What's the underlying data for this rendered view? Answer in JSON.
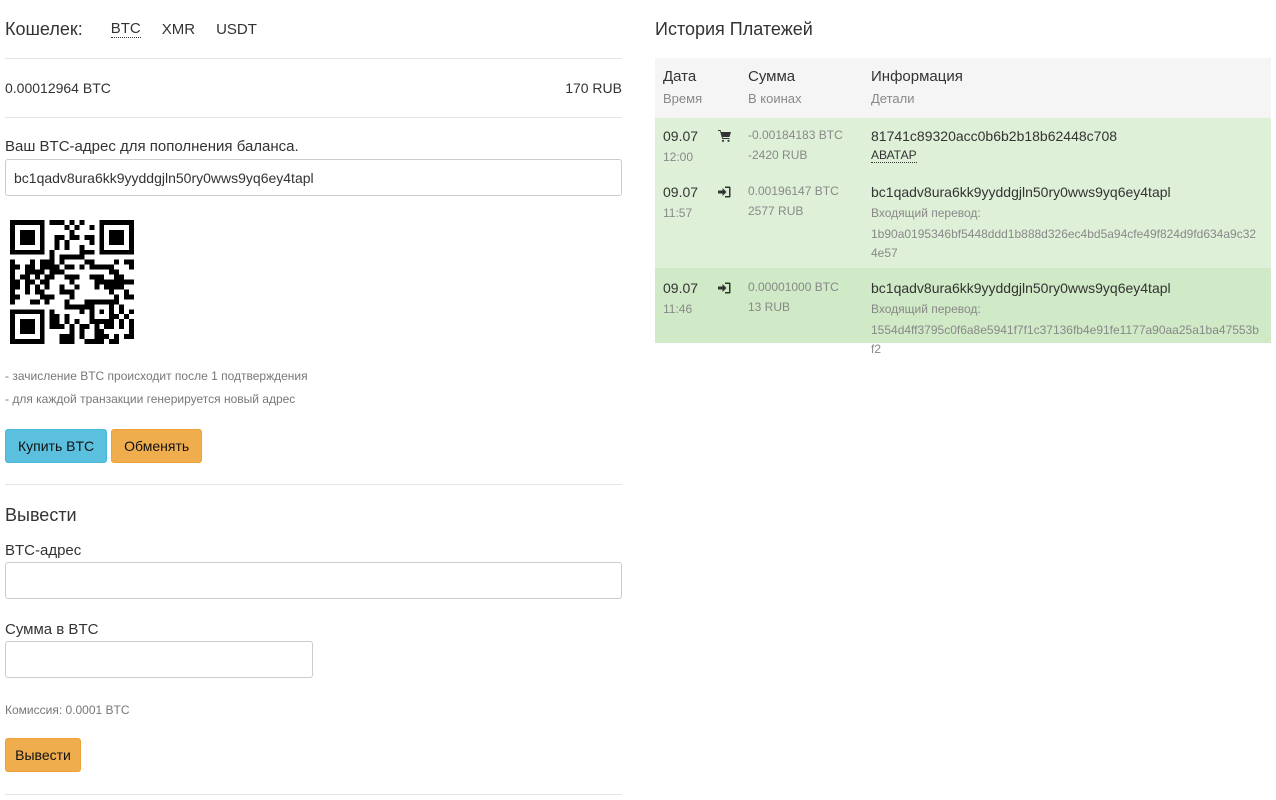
{
  "wallet": {
    "title": "Кошелек:",
    "tabs": [
      "BTC",
      "XMR",
      "USDT"
    ],
    "active_tab": "BTC",
    "balance_crypto": "0.00012964 BTC",
    "balance_fiat": "170 RUB",
    "address_label": "Ваш BTC-адрес для пополнения баланса.",
    "address_value": "bc1qadv8ura6kk9yyddgjln50ry0wws9yq6ey4tapl",
    "notes": [
      "- зачисление BTC происходит после 1 подтверждения",
      "- для каждой транзакции генерируется новый адрес"
    ],
    "buy_button": "Купить BTC",
    "exchange_button": "Обменять"
  },
  "withdraw": {
    "title": "Вывести",
    "address_label": "BTC-адрес",
    "amount_label": "Сумма в BTC",
    "commission": "Комиссия: 0.0001 BTC",
    "submit_button": "Вывести"
  },
  "history": {
    "title": "История Платежей",
    "columns": [
      {
        "main": "Дата",
        "sub": "Время"
      },
      {
        "main": "Сумма",
        "sub": "В коинах"
      },
      {
        "main": "Информация",
        "sub": "Детали"
      }
    ],
    "rows": [
      {
        "date": "09.07",
        "time": "12:00",
        "icon": "cart-icon",
        "amount_crypto": "-0.00184183 BTC",
        "amount_fiat": "-2420 RUB",
        "info_main": "81741c89320acc0b6b2b18b62448c708",
        "info_link": "АВАТАР"
      },
      {
        "date": "09.07",
        "time": "11:57",
        "icon": "sign-in-icon",
        "amount_crypto": "0.00196147 BTC",
        "amount_fiat": "2577 RUB",
        "info_main": "bc1qadv8ura6kk9yyddgjln50ry0wws9yq6ey4tapl",
        "info_sub": "Входящий перевод:",
        "info_detail": "1b90a0195346bf5448ddd1b888d326ec4bd5a94cfe49f824d9fd634a9c324e57"
      },
      {
        "date": "09.07",
        "time": "11:46",
        "icon": "sign-in-icon",
        "amount_crypto": "0.00001000 BTC",
        "amount_fiat": "13 RUB",
        "info_main": "bc1qadv8ura6kk9yyddgjln50ry0wws9yq6ey4tapl",
        "info_sub": "Входящий перевод:",
        "info_detail": "1554d4ff3795c0f6a8e5941f7f1c37136fb4e91fe1177a90aa25a1ba47553bf2"
      }
    ]
  }
}
